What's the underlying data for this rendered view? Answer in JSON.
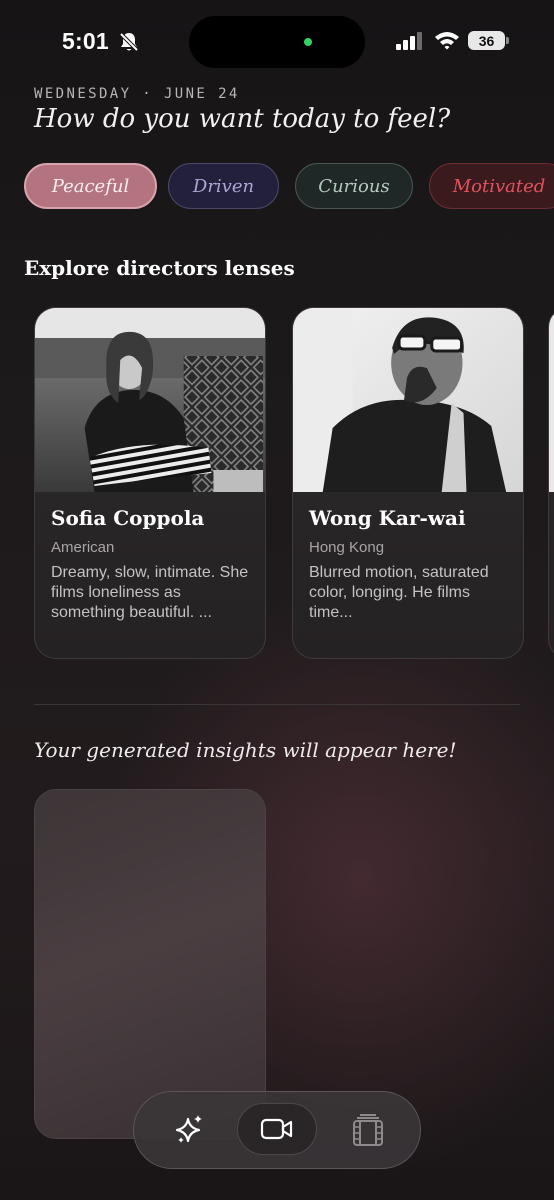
{
  "status_bar": {
    "time": "5:01",
    "battery": "36",
    "icons": [
      "bell-slash-icon",
      "cellular-signal-icon",
      "wifi-icon",
      "battery-icon"
    ],
    "camera_indicator_color": "#35d162"
  },
  "header": {
    "date": "WEDNESDAY · JUNE 24",
    "question": "How do you want today to feel?"
  },
  "moods": [
    {
      "label": "Peaceful",
      "selected": true,
      "color": "#b3747f"
    },
    {
      "label": "Driven",
      "selected": false,
      "color": "#a9a6d6"
    },
    {
      "label": "Curious",
      "selected": false,
      "color": "#b6c9c0"
    },
    {
      "label": "Motivated",
      "selected": false,
      "color": "#e0535f"
    }
  ],
  "directors_section": {
    "title": "Explore directors lenses",
    "cards": [
      {
        "name": "Sofia Coppola",
        "origin": "American",
        "description": "Dreamy, slow, intimate. She films loneliness as something beautiful. ..."
      },
      {
        "name": "Wong Kar-wai",
        "origin": "Hong Kong",
        "description": "Blurred motion, saturated color, longing. He films time..."
      }
    ]
  },
  "insights": {
    "placeholder": "Your generated insights will appear here!"
  },
  "bottom_nav": {
    "items": [
      "sparkles-icon",
      "video-camera-icon",
      "film-strip-icon"
    ],
    "active": "video-camera-icon"
  }
}
